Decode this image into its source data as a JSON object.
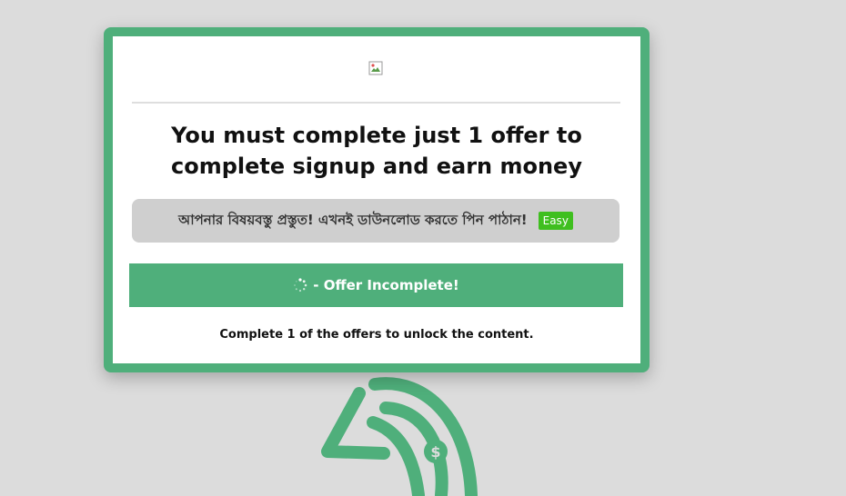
{
  "modal": {
    "headline_line1": "You must complete just 1 offer to",
    "headline_line2": "complete signup and earn money",
    "offer": {
      "text": "আপনার বিষয়বস্তু প্রস্তুত! এখনই ডাউনলোড করতে পিন পাঠান!",
      "badge": "Easy"
    },
    "status": {
      "text": " - Offer Incomplete!"
    },
    "footer_note": "Complete 1 of the offers to unlock the content."
  },
  "colors": {
    "accent": "#4faf7b",
    "badge": "#3fbf1f",
    "background": "#dcdcdc"
  },
  "icons": {
    "logo": "broken-image-icon",
    "spinner": "loading-spinner-icon",
    "background_logo": "money-logo-icon"
  }
}
